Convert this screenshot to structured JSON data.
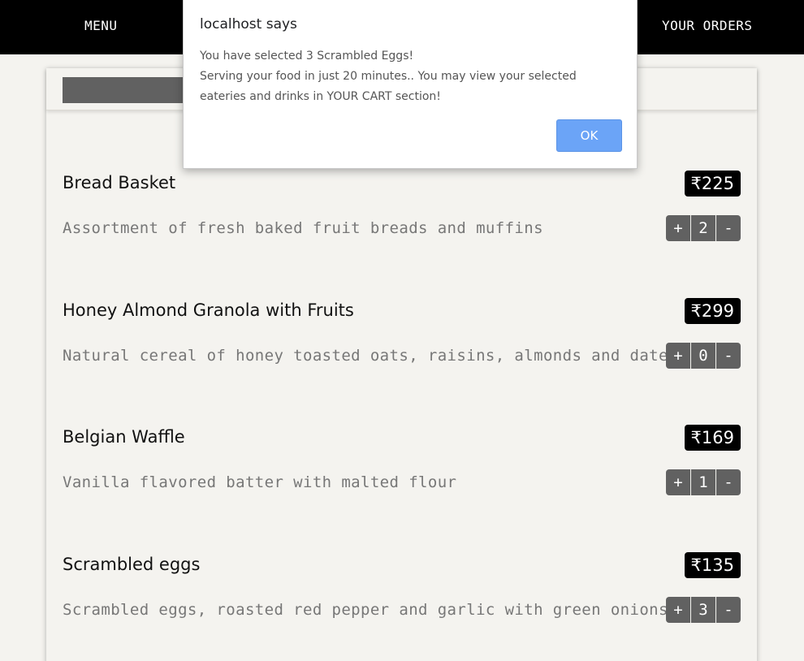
{
  "nav": {
    "menu": "MENU",
    "orders": "YOUR ORDERS"
  },
  "items": [
    {
      "name": "Bread Basket",
      "price": "₹225",
      "description": "Assortment of fresh baked fruit breads and muffins",
      "qty": "2",
      "plus": "+",
      "minus": "-"
    },
    {
      "name": "Honey Almond Granola with Fruits",
      "price": "₹299",
      "description": "Natural cereal of honey toasted oats, raisins, almonds and dates",
      "qty": "0",
      "plus": "+",
      "minus": "-"
    },
    {
      "name": "Belgian Waffle",
      "price": "₹169",
      "description": "Vanilla flavored batter with malted flour",
      "qty": "1",
      "plus": "+",
      "minus": "-"
    },
    {
      "name": "Scrambled eggs",
      "price": "₹135",
      "description": "Scrambled eggs, roasted red pepper and garlic with green onions",
      "qty": "3",
      "plus": "+",
      "minus": "-"
    }
  ],
  "dialog": {
    "title": "localhost says",
    "line1": "You have selected 3 Scrambled Eggs!",
    "line2": "Serving your food in just 20 minutes.. You may view your selected",
    "line3": "eateries and drinks in YOUR CART section!",
    "ok": "OK"
  },
  "colors": {
    "nav_bg": "#000000",
    "page_bg": "#f4f3ef",
    "button_bg": "#616161",
    "ok_button": "#6ba4f7"
  }
}
